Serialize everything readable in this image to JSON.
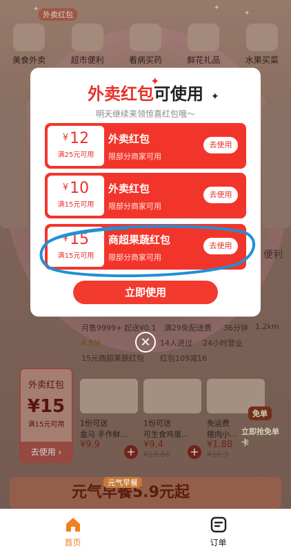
{
  "background": {
    "categories": [
      "美食外卖",
      "超市便利",
      "看病买药",
      "鲜花礼品",
      "水果买菜"
    ],
    "top_badge": "外卖红包",
    "texts": {
      "month_sales": "月售9999+",
      "start_price": "起送¥0.1",
      "delivery": "满29免配送费",
      "time": "36分钟",
      "distance": "1.2km",
      "rating": "4.5分",
      "visits": "14人进过",
      "open": "24小时营业",
      "promo": "15元商超果蔬红包",
      "coupon_count": "红包109减16",
      "side_label": "便利",
      "free_label": "免单",
      "free_sub": "立即抢免单卡"
    },
    "coupon": {
      "title": "外卖红包",
      "amount": "¥15",
      "condition": "满15元可用",
      "use": "去使用 ›"
    },
    "products": [
      {
        "tag": "1份可送",
        "name": "盒马 手作鲜…",
        "price": "¥9.9",
        "old": ""
      },
      {
        "tag": "1份可送",
        "name": "可生食鸡蛋…",
        "price": "¥9.4",
        "old": "¥13.86"
      },
      {
        "tag": "免运费",
        "name": "猪肉小…",
        "price": "¥1.88",
        "old": "¥16.9"
      }
    ],
    "banner_badge": "元气早餐",
    "banner_text": "元气早餐5.9元起"
  },
  "modal": {
    "title_red": "外卖红包",
    "title_black": "可使用",
    "subtitle": "明天继续来领惊喜红包哦～",
    "coupons": [
      {
        "currency": "¥",
        "amount": "12",
        "condition": "满25元可用",
        "name": "外卖红包",
        "desc": "限部分商家可用",
        "button": "去使用"
      },
      {
        "currency": "¥",
        "amount": "10",
        "condition": "满15元可用",
        "name": "外卖红包",
        "desc": "限部分商家可用",
        "button": "去使用"
      },
      {
        "currency": "¥",
        "amount": "15",
        "condition": "满15元可用",
        "name": "商超果蔬红包",
        "desc": "限部分商家可用",
        "button": "去使用"
      }
    ],
    "primary_button": "立即使用",
    "close_icon": "close-icon"
  },
  "tabbar": {
    "tabs": [
      {
        "label": "首页",
        "icon": "home-icon",
        "active": true
      },
      {
        "label": "订单",
        "icon": "order-icon",
        "active": false
      }
    ],
    "accent": "#f08020"
  },
  "colors": {
    "primary_red": "#f2352b",
    "ink_blue": "#1e90d6"
  }
}
